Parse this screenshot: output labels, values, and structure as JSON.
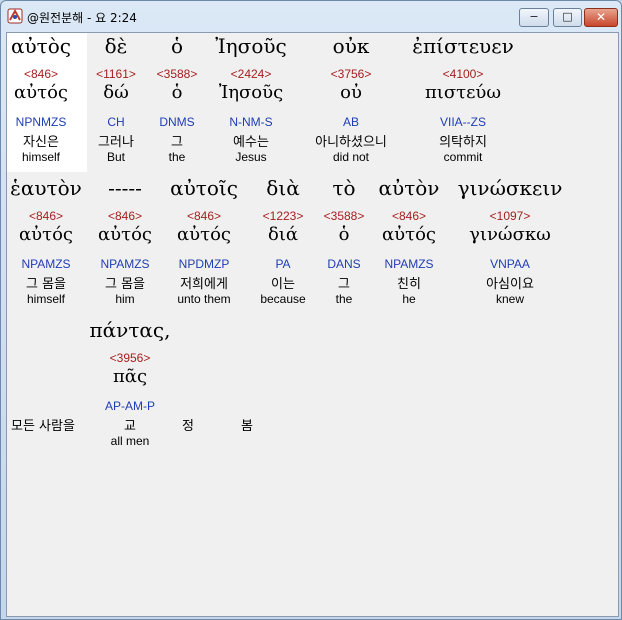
{
  "window": {
    "title": "@원전분해 - 요 2:24",
    "controls": {
      "minimize": "−",
      "maximize": "□",
      "close": "✕"
    }
  },
  "rows": [
    {
      "tokens": [
        {
          "greek": "αὐτὸς",
          "strong": "<846>",
          "lexeme": "αὐτός",
          "parse": "NPNMZS",
          "korean": "자신은",
          "english": "himself"
        },
        {
          "greek": "δὲ",
          "strong": "<1161>",
          "lexeme": "δώ",
          "parse": "CH",
          "korean": "그러나",
          "english": "But"
        },
        {
          "greek": "ὁ",
          "strong": "<3588>",
          "lexeme": "ὁ",
          "parse": "DNMS",
          "korean": "그",
          "english": "the"
        },
        {
          "greek": "Ἰησοῦς",
          "strong": "<2424>",
          "lexeme": "Ἰησοῦς",
          "parse": "N-NM-S",
          "korean": "예수는",
          "english": "Jesus"
        },
        {
          "greek": "οὐκ",
          "strong": "<3756>",
          "lexeme": "οὐ",
          "parse": "AB",
          "korean": "아니하셨으니",
          "english": "did not"
        },
        {
          "greek": "ἐπίστευεν",
          "strong": "<4100>",
          "lexeme": "πιστεύω",
          "parse": "VIIA--ZS",
          "korean": "의탁하지",
          "english": "commit"
        }
      ]
    },
    {
      "tokens": [
        {
          "greek": "ἑαυτὸν",
          "strong": "<846>",
          "lexeme": "αὐτός",
          "parse": "NPAMZS",
          "korean": "그 몸을",
          "english": "himself"
        },
        {
          "greek": "-----",
          "strong": "<846>",
          "lexeme": "αὐτός",
          "parse": "NPAMZS",
          "korean": "그 몸을",
          "english": "him"
        },
        {
          "greek": "αὐτοῖς",
          "strong": "<846>",
          "lexeme": "αὐτός",
          "parse": "NPDMZP",
          "korean": "저희에게",
          "english": "unto them"
        },
        {
          "greek": "διὰ",
          "strong": "<1223>",
          "lexeme": "διά",
          "parse": "PA",
          "korean": "이는",
          "english": "because"
        },
        {
          "greek": "τὸ",
          "strong": "<3588>",
          "lexeme": "ὁ",
          "parse": "DANS",
          "korean": "그",
          "english": "the"
        },
        {
          "greek": "αὐτὸν",
          "strong": "<846>",
          "lexeme": "αὐτός",
          "parse": "NPAMZS",
          "korean": "친히",
          "english": "he"
        },
        {
          "greek": "γινώσκειν",
          "strong": "<1097>",
          "lexeme": "γινώσκω",
          "parse": "VNPAA",
          "korean": "아심이요",
          "english": "knew"
        }
      ]
    },
    {
      "tokens": [
        {
          "greek": "πάντας,",
          "strong": "<3956>",
          "lexeme": "πᾶς",
          "parse": "AP-AM-P",
          "korean": "교",
          "english": "all men"
        }
      ]
    }
  ],
  "free_korean": {
    "part1": "모든 사람을",
    "part2": "정",
    "part3": "봄"
  }
}
